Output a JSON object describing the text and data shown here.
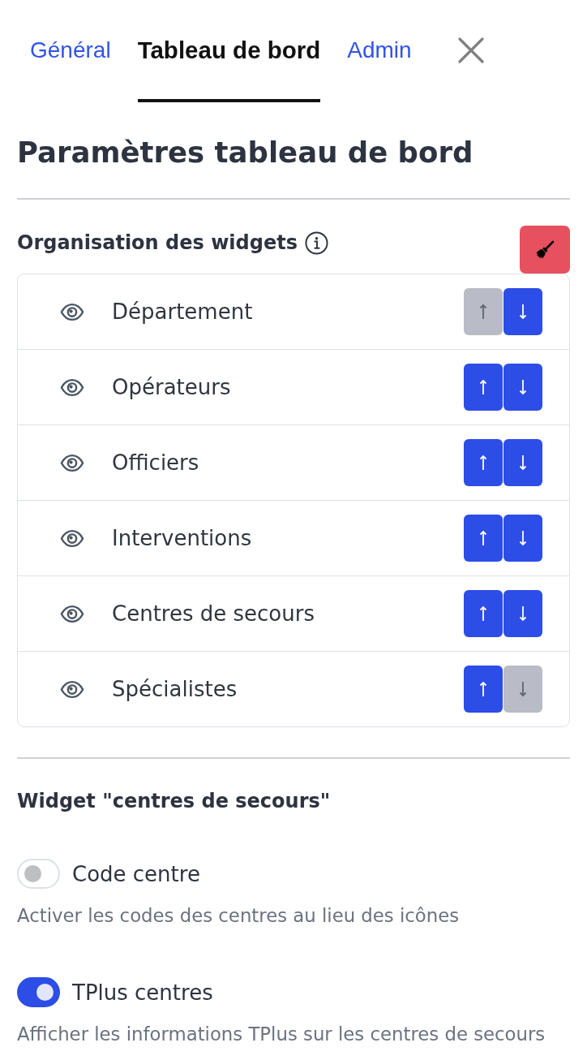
{
  "tabs": [
    {
      "label": "Général",
      "selected": false
    },
    {
      "label": "Tableau de bord",
      "selected": true
    },
    {
      "label": "Admin",
      "selected": false
    }
  ],
  "title": "Paramètres tableau de bord",
  "widgets_section": {
    "title": "Organisation des widgets",
    "widgets": [
      {
        "name": "Département",
        "move_up": {
          "disabled": true
        },
        "move_down": {
          "disabled": false
        }
      },
      {
        "name": "Opérateurs",
        "move_up": {
          "disabled": false
        },
        "move_down": {
          "disabled": false
        }
      },
      {
        "name": "Officiers",
        "move_up": {
          "disabled": false
        },
        "move_down": {
          "disabled": false
        }
      },
      {
        "name": "Interventions",
        "move_up": {
          "disabled": false
        },
        "move_down": {
          "disabled": false
        }
      },
      {
        "name": "Centres de secours",
        "move_up": {
          "disabled": false
        },
        "move_down": {
          "disabled": false
        }
      },
      {
        "name": "Spécialistes",
        "move_up": {
          "disabled": false
        },
        "move_down": {
          "disabled": true
        }
      }
    ]
  },
  "widget_settings": {
    "title": "Widget \"centres de secours\"",
    "options": [
      {
        "label": "Code centre",
        "on": false,
        "description": "Activer les codes des centres au lieu des icônes"
      },
      {
        "label": "TPlus centres",
        "on": true,
        "description": "Afficher les informations TPlus sur les centres de secours"
      }
    ]
  }
}
